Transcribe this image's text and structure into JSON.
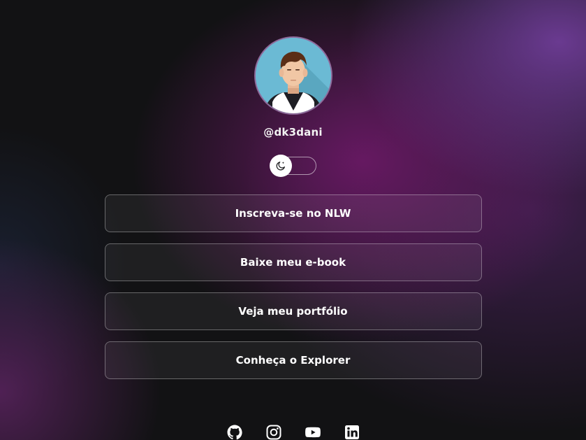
{
  "profile": {
    "username": "@dk3dani",
    "avatar_icon": "avatar-illustration"
  },
  "theme_switch": {
    "icon": "moon-icon",
    "state": "dark"
  },
  "links": [
    {
      "label": "Inscreva-se no NLW"
    },
    {
      "label": "Baixe meu e-book"
    },
    {
      "label": "Veja meu portfólio"
    },
    {
      "label": "Conheça o Explorer"
    }
  ],
  "social": [
    {
      "icon": "github-icon"
    },
    {
      "icon": "instagram-icon"
    },
    {
      "icon": "youtube-icon"
    },
    {
      "icon": "linkedin-icon"
    }
  ],
  "colors": {
    "background": "#121214",
    "accent_purple": "#6e3c96",
    "accent_magenta": "#691964",
    "text": "#ffffff"
  }
}
